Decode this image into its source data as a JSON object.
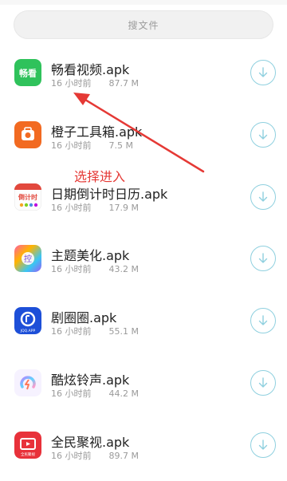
{
  "search": {
    "placeholder": "搜文件"
  },
  "files": [
    {
      "name": "畅看视频.apk",
      "time": "16 小时前",
      "size": "87.7 M",
      "icon": "changkan-app-icon",
      "icon_text": "畅看"
    },
    {
      "name": "橙子工具箱.apk",
      "time": "16 小时前",
      "size": "7.5 M",
      "icon": "chengzi-toolbox-icon"
    },
    {
      "name": "日期倒计时日历.apk",
      "time": "16 小时前",
      "size": "17.9 M",
      "icon": "countdown-calendar-icon",
      "icon_text": "倒计时"
    },
    {
      "name": "主题美化.apk",
      "time": "16 小时前",
      "size": "43.2 M",
      "icon": "theme-beautify-icon",
      "icon_text": "控"
    },
    {
      "name": "剧圈圈.apk",
      "time": "16 小时前",
      "size": "55.1 M",
      "icon": "juquanquan-icon",
      "icon_text": "JQQ.APP"
    },
    {
      "name": "酷炫铃声.apk",
      "time": "16 小时前",
      "size": "44.2 M",
      "icon": "cool-ringtone-icon"
    },
    {
      "name": "全民聚视.apk",
      "time": "16 小时前",
      "size": "89.7 M",
      "icon": "quanmin-jushi-icon",
      "icon_text": "全民聚视"
    }
  ],
  "annotation": {
    "text": "选择进入",
    "color": "#e53935"
  },
  "colors": {
    "accent": "#8fd0df",
    "changkan": "#2fc25b"
  }
}
